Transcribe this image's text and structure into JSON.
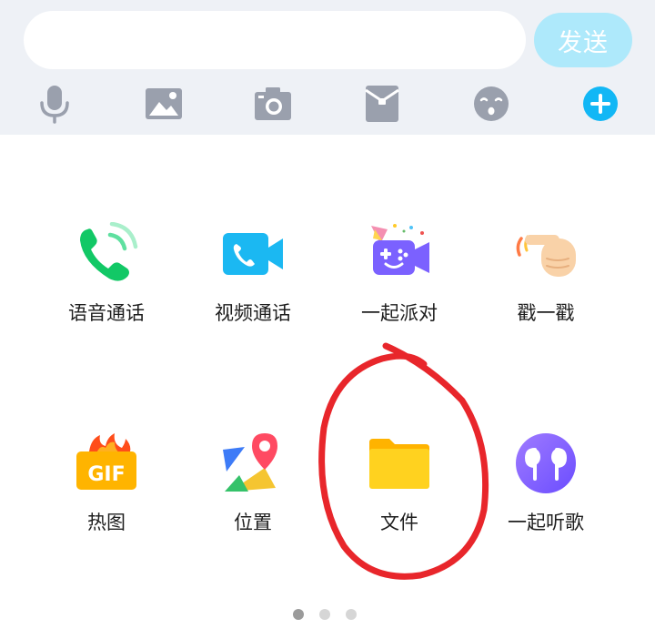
{
  "input": {
    "value": "",
    "placeholder": ""
  },
  "send_label": "发送",
  "toolbar": [
    {
      "icon": "microphone-icon"
    },
    {
      "icon": "image-icon"
    },
    {
      "icon": "camera-icon"
    },
    {
      "icon": "red-packet-icon"
    },
    {
      "icon": "emoji-icon"
    },
    {
      "icon": "plus-icon"
    }
  ],
  "apps": [
    {
      "label": "语音通话",
      "icon": "phone-call-icon"
    },
    {
      "label": "视频通话",
      "icon": "video-call-icon"
    },
    {
      "label": "一起派对",
      "icon": "party-game-icon"
    },
    {
      "label": "戳一戳",
      "icon": "poke-hand-icon"
    },
    {
      "label": "热图",
      "icon": "gif-icon"
    },
    {
      "label": "位置",
      "icon": "location-map-icon"
    },
    {
      "label": "文件",
      "icon": "folder-icon"
    },
    {
      "label": "一起听歌",
      "icon": "headphones-icon"
    }
  ],
  "pagination": {
    "pages": 3,
    "current": 1
  },
  "colors": {
    "accent": "#12b7f5",
    "toolbar_bg": "#eef1f6",
    "icon_gray": "#9aa0ad",
    "annotation": "#e8262b"
  }
}
